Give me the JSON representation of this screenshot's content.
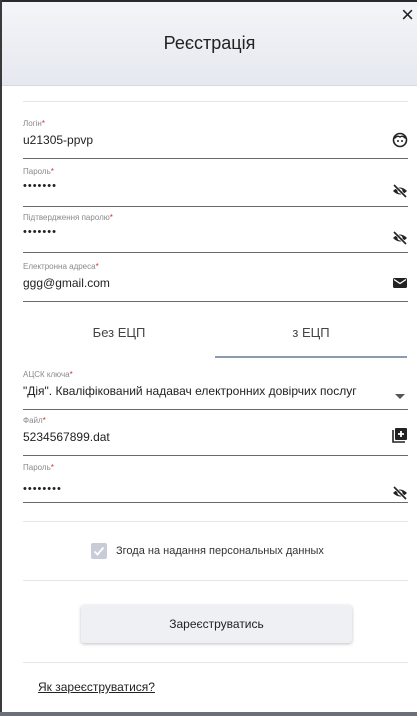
{
  "header": {
    "title": "Реєстрація",
    "close": "×"
  },
  "fields": {
    "login": {
      "label": "Логін",
      "value": "u21305-ppvp"
    },
    "password": {
      "label": "Пароль",
      "value": "•••••••"
    },
    "confirm": {
      "label": "Підтвердження паролю",
      "value": "•••••••"
    },
    "email": {
      "label": "Електронна адреса",
      "value": "ggg@gmail.com"
    }
  },
  "tabs": [
    {
      "label": "Без ЕЦП",
      "active": false
    },
    {
      "label": "з ЕЦП",
      "active": true
    }
  ],
  "ecp": {
    "acsk": {
      "label": "АЦСК ключа",
      "value": "\"Дія\". Кваліфікований надавач електронних довірчих послуг"
    },
    "file": {
      "label": "Файл",
      "value": "5234567899.dat"
    },
    "key_password": {
      "label": "Пароль",
      "value": "••••••••"
    }
  },
  "required_mark": "*",
  "consent": {
    "label": "Згода на надання персональных данных",
    "checked": true
  },
  "register_button": "Зареєструватись",
  "how_to_link": "Як зареєструватися?",
  "icons": {
    "login": "face-icon",
    "password": "eye-off-icon",
    "email": "mail-icon",
    "acsk": "dropdown-arrow-icon",
    "file": "add-box-icon"
  },
  "colors": {
    "accent": "#8c9bb0",
    "required": "#d32f2f",
    "header_bg": "#eceef4",
    "checkbox": "#c7ccd6"
  }
}
